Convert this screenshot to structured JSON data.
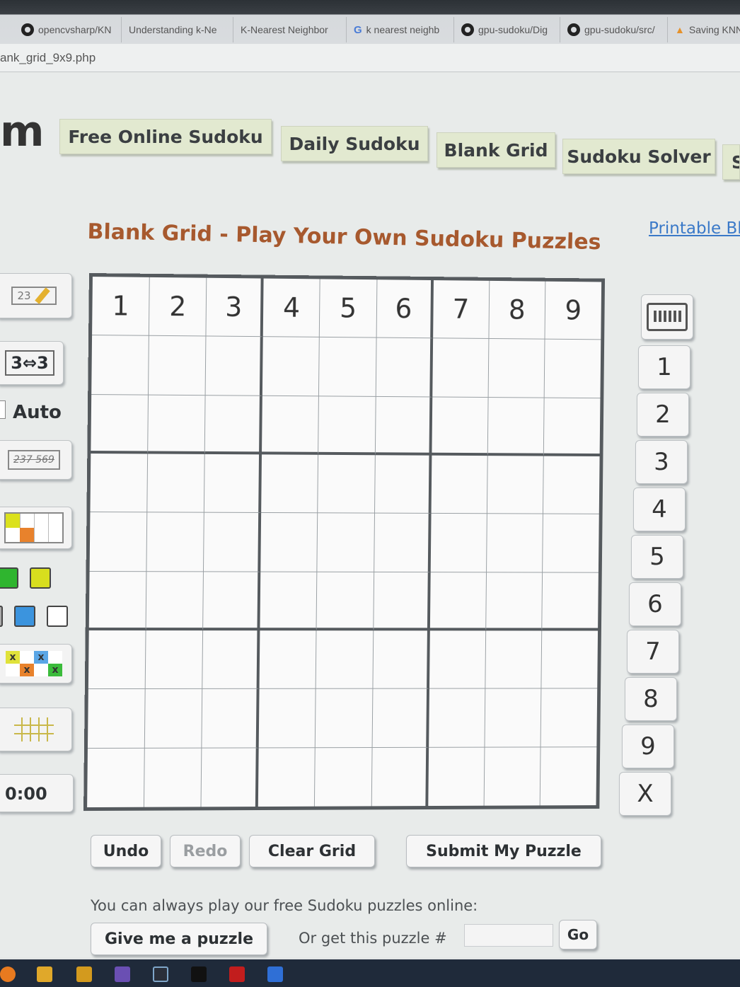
{
  "browser": {
    "tabs": [
      {
        "icon": "github-icon",
        "label": "opencvsharp/KN"
      },
      {
        "icon": "",
        "label": "Understanding k-Ne"
      },
      {
        "icon": "",
        "label": "K-Nearest Neighbor"
      },
      {
        "icon": "google-icon",
        "label": "k nearest neighb"
      },
      {
        "icon": "github-icon",
        "label": "gpu-sudoku/Dig"
      },
      {
        "icon": "github-icon",
        "label": "gpu-sudoku/src/"
      },
      {
        "icon": "flame-icon",
        "label": "Saving KNN"
      }
    ],
    "url": "ank_grid_9x9.php"
  },
  "header": {
    "logo_fragment": "m",
    "nav": [
      "Free Online Sudoku",
      "Daily Sudoku",
      "Blank Grid",
      "Sudoku Solver",
      "S"
    ]
  },
  "page": {
    "title": "Blank Grid - Play Your Own Sudoku Puzzles",
    "printable_link": "Printable Bl"
  },
  "left_tools": {
    "pencil_label": "23",
    "swap_label": "3⇔3",
    "auto_label": "Auto",
    "candidates_label": "237 569",
    "timer": "0:00"
  },
  "grid": {
    "rows": [
      [
        "1",
        "2",
        "3",
        "4",
        "5",
        "6",
        "7",
        "8",
        "9"
      ],
      [
        "",
        "",
        "",
        "",
        "",
        "",
        "",
        "",
        ""
      ],
      [
        "",
        "",
        "",
        "",
        "",
        "",
        "",
        "",
        ""
      ],
      [
        "",
        "",
        "",
        "",
        "",
        "",
        "",
        "",
        ""
      ],
      [
        "",
        "",
        "",
        "",
        "",
        "",
        "",
        "",
        ""
      ],
      [
        "",
        "",
        "",
        "",
        "",
        "",
        "",
        "",
        ""
      ],
      [
        "",
        "",
        "",
        "",
        "",
        "",
        "",
        "",
        ""
      ],
      [
        "",
        "",
        "",
        "",
        "",
        "",
        "",
        "",
        ""
      ],
      [
        "",
        "",
        "",
        "",
        "",
        "",
        "",
        "",
        ""
      ]
    ]
  },
  "keypad": {
    "keys": [
      "1",
      "2",
      "3",
      "4",
      "5",
      "6",
      "7",
      "8",
      "9",
      "X"
    ]
  },
  "actions": {
    "undo": "Undo",
    "redo": "Redo",
    "clear": "Clear Grid",
    "submit": "Submit My Puzzle"
  },
  "footer": {
    "hint": "You can always play our free Sudoku puzzles online:",
    "give_puzzle": "Give me a puzzle",
    "or_label": "Or get this puzzle #",
    "go": "Go"
  },
  "colors": {
    "title": "#a7592e",
    "nav_bg": "#e2e9d0",
    "link": "#3a79c8",
    "grid_border": "#555a5e"
  }
}
